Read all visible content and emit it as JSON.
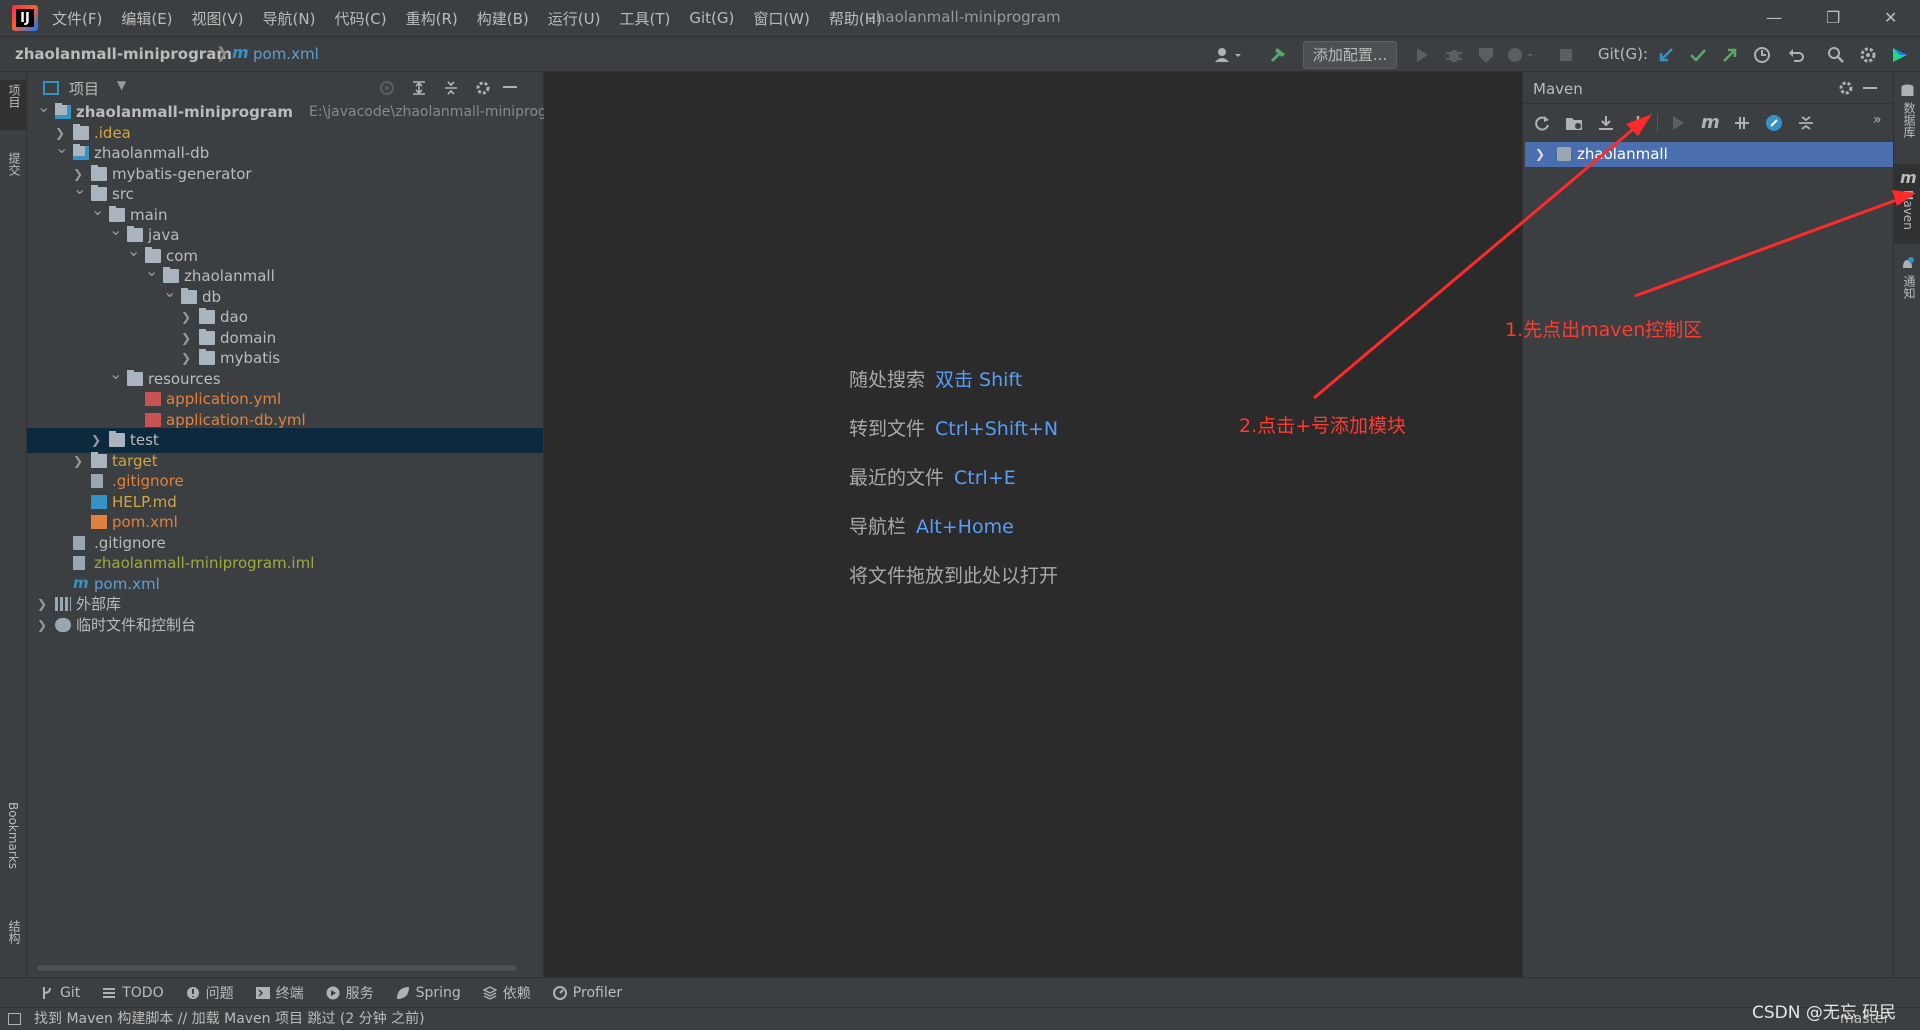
{
  "app": {
    "window_title": "zhaolanmall-miniprogram",
    "logo_text": "IJ"
  },
  "menu": [
    "文件(F)",
    "编辑(E)",
    "视图(V)",
    "导航(N)",
    "代码(C)",
    "重构(R)",
    "构建(B)",
    "运行(U)",
    "工具(T)",
    "Git(G)",
    "窗口(W)",
    "帮助(H)"
  ],
  "breadcrumb": {
    "project": "zhaolanmall-miniprogram",
    "file_icon": "m",
    "file": "pom.xml"
  },
  "toolbar": {
    "add_config": "添加配置...",
    "git_label": "Git(G):"
  },
  "left_strip": {
    "project": "项目",
    "commit": "提交",
    "bookmarks": "Bookmarks",
    "structure": "结构"
  },
  "project_panel": {
    "title": "项目",
    "rows": [
      {
        "label": "zhaolanmall-miniprogram",
        "path": "E:\\javacode\\zhaolanmall-miniprogra",
        "bold": true
      },
      {
        "label": ".idea"
      },
      {
        "label": "zhaolanmall-db"
      },
      {
        "label": "mybatis-generator"
      },
      {
        "label": "src"
      },
      {
        "label": "main"
      },
      {
        "label": "java"
      },
      {
        "label": "com"
      },
      {
        "label": "zhaolanmall"
      },
      {
        "label": "db"
      },
      {
        "label": "dao"
      },
      {
        "label": "domain"
      },
      {
        "label": "mybatis"
      },
      {
        "label": "resources"
      },
      {
        "label": "application.yml"
      },
      {
        "label": "application-db.yml"
      },
      {
        "label": "test"
      },
      {
        "label": "target"
      },
      {
        "label": ".gitignore"
      },
      {
        "label": "HELP.md"
      },
      {
        "label": "pom.xml"
      },
      {
        "label": ".gitignore"
      },
      {
        "label": "zhaolanmall-miniprogram.iml"
      },
      {
        "label": "pom.xml"
      },
      {
        "label": "外部库"
      },
      {
        "label": "临时文件和控制台"
      }
    ]
  },
  "editor_hints": [
    {
      "text": "随处搜索",
      "key": "双击 Shift"
    },
    {
      "text": "转到文件",
      "key": "Ctrl+Shift+N"
    },
    {
      "text": "最近的文件",
      "key": "Ctrl+E"
    },
    {
      "text": "导航栏",
      "key": "Alt+Home"
    },
    {
      "text": "将文件拖放到此处以打开",
      "key": ""
    }
  ],
  "maven": {
    "title": "Maven",
    "item": "zhaolanmall"
  },
  "right_strip": {
    "database": "数据库",
    "maven": "Maven",
    "notifications": "通知"
  },
  "tool_windows": [
    "Git",
    "TODO",
    "问题",
    "终端",
    "服务",
    "Spring",
    "依赖",
    "Profiler"
  ],
  "status": {
    "message": "找到 Maven 构建脚本 // 加载 Maven 项目   跳过 (2 分钟 之前)",
    "branch": "master",
    "watermark": "CSDN @无忘 码民"
  },
  "annotations": {
    "step1": "1.先点出maven控制区",
    "step2": "2.点击+号添加模块"
  },
  "colors": {
    "accent": "#4b6eaf",
    "annotation": "#ff3b30",
    "link": "#589df6",
    "yellow_text": "#d0a63e",
    "orange_text": "#e0823d",
    "olive_text": "#a0a93b"
  }
}
